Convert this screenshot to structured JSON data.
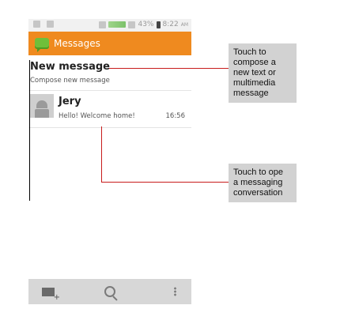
{
  "status_bar": {
    "battery_percent": "43%",
    "time": "8:22",
    "ampm": "AM"
  },
  "action_bar": {
    "title": "Messages",
    "app_icon": "messaging-app-icon"
  },
  "new_message": {
    "title": "New message",
    "subtitle": "Compose new message"
  },
  "threads": [
    {
      "name": "Jery",
      "snippet": "Hello! Welcome home!",
      "time": "16:56",
      "avatar_icon": "contact-avatar-icon"
    }
  ],
  "bottom_bar": {
    "icons": [
      "compose-icon",
      "search-icon",
      "overflow-menu-icon"
    ]
  },
  "callouts": [
    {
      "text": "Touch to\ncompose a\nnew text or\nmultimedia\nmessage"
    },
    {
      "text": "Touch to ope\na messaging\nconversation"
    }
  ],
  "colors": {
    "action_bar": "#ef8a1f",
    "leader_line": "#c81c1c",
    "callout_bg": "#d2d2d2"
  }
}
